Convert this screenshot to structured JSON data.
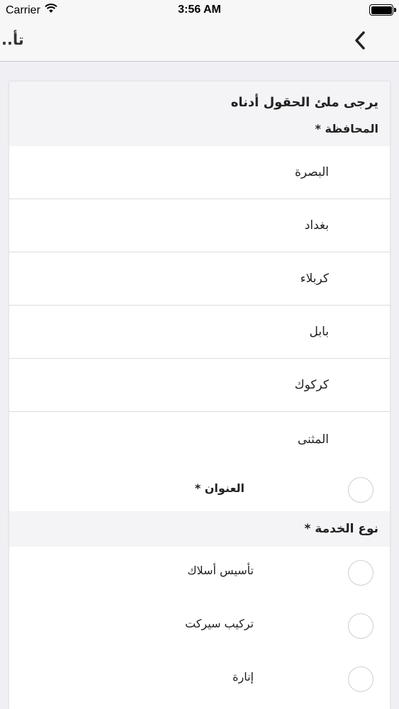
{
  "status_bar": {
    "carrier": "Carrier",
    "time": "3:56 AM",
    "wifi_icon": "wifi-icon",
    "battery_icon": "battery-icon"
  },
  "nav": {
    "title": "تأ..",
    "back_icon": "chevron-left-icon"
  },
  "form": {
    "heading": "يرجى ملئ الحقول أدناه",
    "governorate_label": "المحافظة *",
    "governorates": [
      "البصرة",
      "بغداد",
      "كربلاء",
      "بابل",
      "كركوك",
      "المثنى"
    ],
    "address_label": "العنوان *",
    "service_type_label": "نوع الخدمة *",
    "services": [
      "تأسيس أسلاك",
      "تركيب سيركت",
      "إنارة"
    ]
  },
  "colors": {
    "background": "#efeff4",
    "nav_bar": "#f7f7f7",
    "card": "#ffffff",
    "section_header": "#f4f4f7",
    "radio_border": "#cfcfcf"
  }
}
